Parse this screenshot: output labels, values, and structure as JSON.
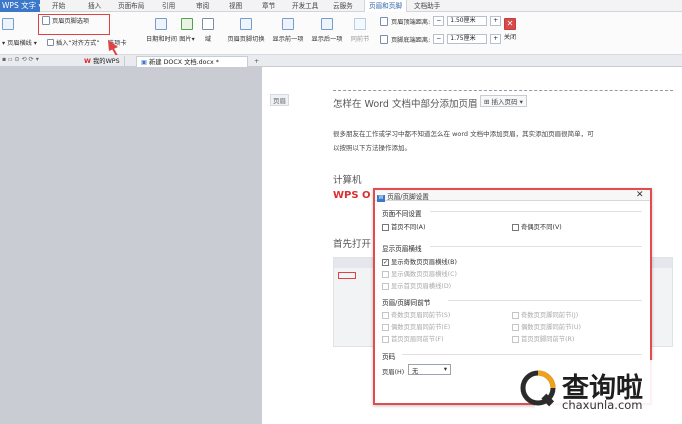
{
  "app": {
    "title": "WPS 文字"
  },
  "menu": {
    "items": [
      "开始",
      "插入",
      "页面布局",
      "引用",
      "审阅",
      "视图",
      "章节",
      "开发工具",
      "云服务",
      "页眉和页脚",
      "文档助手"
    ],
    "active": "页眉和页脚"
  },
  "ribbon": {
    "options_label": "页眉页脚选项",
    "header_line_label": "页眉横线",
    "insert_align_label": "插入“对齐方式”",
    "tab_label": "选项卡",
    "datetime_label": "日期和时间",
    "image_label": "图片",
    "field_label": "域",
    "switch_label": "页眉页脚切换",
    "show_prev_label": "显示前一项",
    "show_next_label": "显示后一项",
    "sync_label": "同前节",
    "header_top_label": "页眉顶端距离:",
    "header_top_value": "1.50厘米",
    "footer_bottom_label": "页脚底端距离:",
    "footer_bottom_value": "1.75厘米",
    "close_label": "关闭"
  },
  "tabs": {
    "tab1": "我的WPS",
    "tab2": "新建 DOCX 文档.docx *"
  },
  "doc": {
    "header_tag": "页眉",
    "insert_page_btn": "插入页码",
    "heading": "怎样在 Word 文档中部分添加页眉",
    "para1": "很多朋友在工作或学习中都不知道怎么在 word 文档中添加页眉，其实添加页眉很简单，可",
    "para2": "以按照以下方法操作添加。",
    "sub1": "计算机",
    "wps": "WPS O",
    "first_open": "首先打开"
  },
  "dialog": {
    "title": "页眉/页脚设置",
    "sec_diff": "页面不同设置",
    "first_diff": "首页不同(A)",
    "odd_even": "奇偶页不同(V)",
    "sec_lines": "显示页眉横线",
    "odd_line": "显示奇数页页眉横线(B)",
    "even_line": "显示偶数页页眉横线(C)",
    "first_line": "显示首页页眉横线(D)",
    "sec_sync": "页眉/页脚同前节",
    "odd_hdr": "奇数页页眉同前节(S)",
    "even_hdr": "偶数页页眉同前节(E)",
    "first_hdr": "首页页眉同前节(F)",
    "odd_ftr": "奇数页页脚同前节(J)",
    "even_ftr": "偶数页页脚同前节(U)",
    "first_ftr": "首页页脚同前节(R)",
    "sec_pagenum": "页码",
    "header_label": "页眉(H)",
    "header_value": "无"
  },
  "watermark": {
    "cn": "查询啦",
    "en": "chaxunla.com"
  },
  "colors": {
    "accent": "#e24c4c",
    "menu_blue": "#3b78c9",
    "tab_wps": "#d7262e"
  }
}
